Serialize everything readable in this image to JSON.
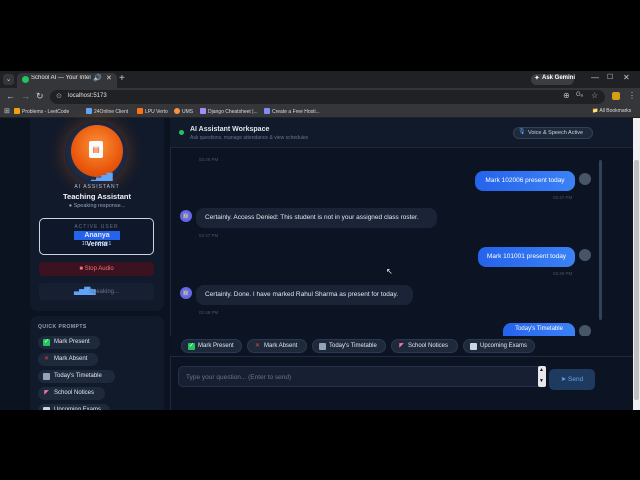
{
  "browser": {
    "tab_title": "School AI — Your Intelligen",
    "new_tab": "+",
    "gemini_label": "Ask Gemini",
    "url": "localhost:5173",
    "bookmarks": [
      "Problems - LeetCode",
      "24Online Client",
      "LPU Verto",
      "UMS",
      "Django Cheatsheet |...",
      "Create a Free Hosti..."
    ],
    "all_bookmarks": "All Bookmarks"
  },
  "assistant": {
    "role": "AI ASSISTANT",
    "name": "Teaching Assistant",
    "status": "Speaking response..."
  },
  "user": {
    "label": "ACTIVE USER",
    "name": "Ananya Verma",
    "id": "ID: 50001"
  },
  "controls": {
    "stop_audio": "Stop Audio",
    "speaking": "Speaking..."
  },
  "quick_prompts": {
    "title": "QUICK PROMPTS",
    "items": [
      "Mark Present",
      "Mark Absent",
      "Today's Timetable",
      "School Notices",
      "Upcoming Exams"
    ]
  },
  "header": {
    "title": "AI Assistant Workspace",
    "subtitle": "Ask questions, manage attendance & view schedules",
    "voice_badge": "Voice & Speech Active"
  },
  "messages": [
    {
      "from": "ai",
      "time": "02:46 PM"
    },
    {
      "from": "user",
      "text": "Mark 102006 present today",
      "time": "02:47 PM"
    },
    {
      "from": "ai",
      "text": "Certainly. Access Denied: This student is not in your assigned class roster.",
      "time": "02:47 PM"
    },
    {
      "from": "user",
      "text": "Mark 101001 present today",
      "time": "02:48 PM"
    },
    {
      "from": "ai",
      "text": "Certainly. Done. I have marked Rahul Sharma as present for today.",
      "time": "02:48 PM"
    },
    {
      "from": "user",
      "text": "Today's Timetable"
    }
  ],
  "chips": [
    "Mark Present",
    "Mark Absent",
    "Today's Timetable",
    "School Notices",
    "Upcoming Exams"
  ],
  "composer": {
    "placeholder": "Type your question... (Enter to send)",
    "send_label": "Send"
  },
  "colors": {
    "accent": "#3b82f6",
    "app_bg": "#0b1220",
    "avatar_orange": "#ea580c",
    "status_green": "#22c55e"
  }
}
